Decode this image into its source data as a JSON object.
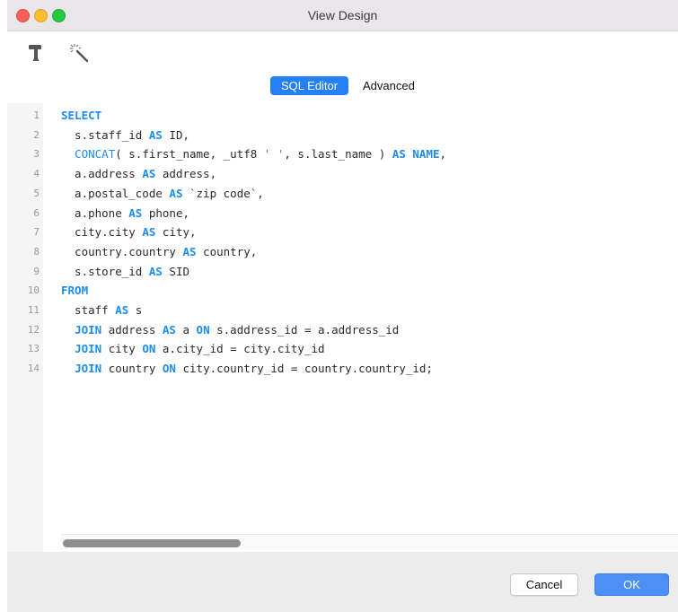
{
  "window": {
    "title": "View Design"
  },
  "toolbar": {
    "icons": [
      "hammer-icon",
      "magic-wand-icon"
    ]
  },
  "tabs": [
    {
      "label": "SQL Editor",
      "active": true
    },
    {
      "label": "Advanced",
      "active": false
    }
  ],
  "editor": {
    "line_numbers": [
      "1",
      "2",
      "3",
      "4",
      "5",
      "6",
      "7",
      "8",
      "9",
      "10",
      "11",
      "12",
      "13",
      "14"
    ],
    "lines": [
      [
        {
          "t": "SELECT",
          "c": "kw"
        }
      ],
      [
        {
          "t": "  s.staff_id ",
          "c": ""
        },
        {
          "t": "AS",
          "c": "kw"
        },
        {
          "t": " ID,",
          "c": ""
        }
      ],
      [
        {
          "t": "  ",
          "c": ""
        },
        {
          "t": "CONCAT",
          "c": "fn"
        },
        {
          "t": "( s.first_name, _utf8 ",
          "c": ""
        },
        {
          "t": "' '",
          "c": "str"
        },
        {
          "t": ", s.last_name ) ",
          "c": ""
        },
        {
          "t": "AS",
          "c": "kw"
        },
        {
          "t": " ",
          "c": ""
        },
        {
          "t": "NAME",
          "c": "kw"
        },
        {
          "t": ",",
          "c": ""
        }
      ],
      [
        {
          "t": "  a.address ",
          "c": ""
        },
        {
          "t": "AS",
          "c": "kw"
        },
        {
          "t": " address,",
          "c": ""
        }
      ],
      [
        {
          "t": "  a.postal_code ",
          "c": ""
        },
        {
          "t": "AS",
          "c": "kw"
        },
        {
          "t": " `zip code`,",
          "c": ""
        }
      ],
      [
        {
          "t": "  a.phone ",
          "c": ""
        },
        {
          "t": "AS",
          "c": "kw"
        },
        {
          "t": " phone,",
          "c": ""
        }
      ],
      [
        {
          "t": "  city.city ",
          "c": ""
        },
        {
          "t": "AS",
          "c": "kw"
        },
        {
          "t": " city,",
          "c": ""
        }
      ],
      [
        {
          "t": "  country.country ",
          "c": ""
        },
        {
          "t": "AS",
          "c": "kw"
        },
        {
          "t": " country,",
          "c": ""
        }
      ],
      [
        {
          "t": "  s.store_id ",
          "c": ""
        },
        {
          "t": "AS",
          "c": "kw"
        },
        {
          "t": " SID",
          "c": ""
        }
      ],
      [
        {
          "t": "FROM",
          "c": "kw"
        }
      ],
      [
        {
          "t": "  staff ",
          "c": ""
        },
        {
          "t": "AS",
          "c": "kw"
        },
        {
          "t": " s",
          "c": ""
        }
      ],
      [
        {
          "t": "  ",
          "c": ""
        },
        {
          "t": "JOIN",
          "c": "kw"
        },
        {
          "t": " address ",
          "c": ""
        },
        {
          "t": "AS",
          "c": "kw"
        },
        {
          "t": " a ",
          "c": ""
        },
        {
          "t": "ON",
          "c": "kw"
        },
        {
          "t": " s.address_id = a.address_id",
          "c": ""
        }
      ],
      [
        {
          "t": "  ",
          "c": ""
        },
        {
          "t": "JOIN",
          "c": "kw"
        },
        {
          "t": " city ",
          "c": ""
        },
        {
          "t": "ON",
          "c": "kw"
        },
        {
          "t": " a.city_id = city.city_id",
          "c": ""
        }
      ],
      [
        {
          "t": "  ",
          "c": ""
        },
        {
          "t": "JOIN",
          "c": "kw"
        },
        {
          "t": " country ",
          "c": ""
        },
        {
          "t": "ON",
          "c": "kw"
        },
        {
          "t": " city.country_id = country.country_id;",
          "c": ""
        }
      ]
    ]
  },
  "footer": {
    "cancel_label": "Cancel",
    "ok_label": "OK"
  },
  "colors": {
    "accent": "#2580f8",
    "keyword": "#1c8cf0",
    "string": "#e0427a"
  }
}
